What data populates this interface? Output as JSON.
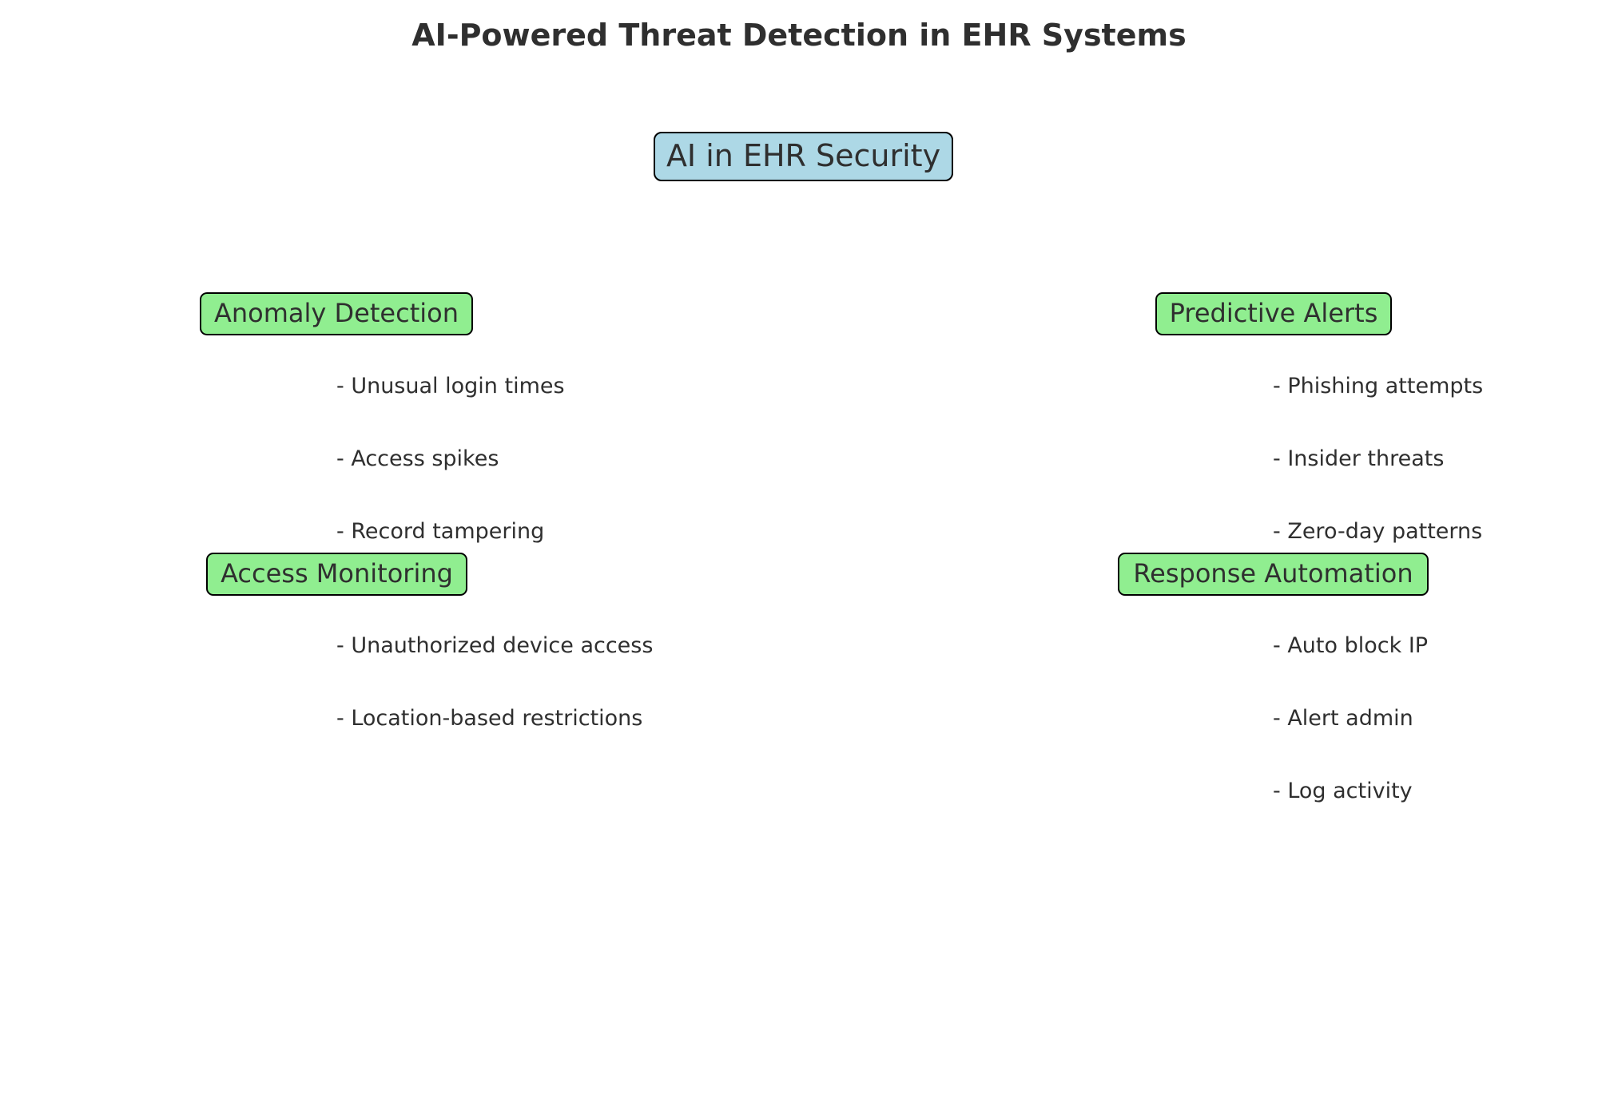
{
  "title": "AI-Powered Threat Detection in EHR Systems",
  "root": "AI in EHR Security",
  "colors": {
    "root_fill": "#add8e6",
    "branch_fill": "#90ee90",
    "border": "#000000",
    "text": "#2f2f2f"
  },
  "branches": [
    {
      "label": "Anomaly Detection",
      "items": [
        "- Unusual login times",
        "- Access spikes",
        "- Record tampering"
      ]
    },
    {
      "label": "Predictive Alerts",
      "items": [
        "- Phishing attempts",
        "- Insider threats",
        "- Zero-day patterns"
      ]
    },
    {
      "label": "Access Monitoring",
      "items": [
        "- Unauthorized device access",
        "- Location-based restrictions"
      ]
    },
    {
      "label": "Response Automation",
      "items": [
        "- Auto block IP",
        "- Alert admin",
        "- Log activity"
      ]
    }
  ]
}
